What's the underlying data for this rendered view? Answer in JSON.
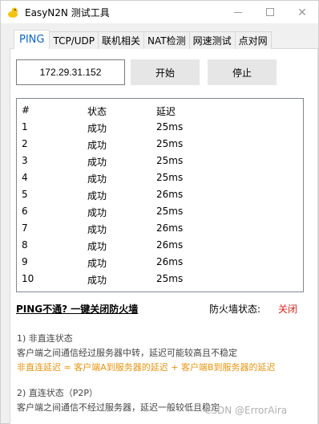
{
  "window": {
    "title": "EasyN2N 测试工具",
    "icon": "duck-icon"
  },
  "tabs": [
    {
      "label": "PING",
      "active": true
    },
    {
      "label": "TCP/UDP",
      "active": false
    },
    {
      "label": "联机相关",
      "active": false
    },
    {
      "label": "NAT检测",
      "active": false
    },
    {
      "label": "网速测试",
      "active": false
    },
    {
      "label": "点对网",
      "active": false
    }
  ],
  "controls": {
    "ip_value": "172.29.31.152",
    "start_label": "开始",
    "stop_label": "停止"
  },
  "results": {
    "headers": [
      "#",
      "状态",
      "延迟"
    ],
    "rows": [
      [
        "1",
        "成功",
        "25ms"
      ],
      [
        "2",
        "成功",
        "25ms"
      ],
      [
        "3",
        "成功",
        "25ms"
      ],
      [
        "4",
        "成功",
        "25ms"
      ],
      [
        "5",
        "成功",
        "26ms"
      ],
      [
        "6",
        "成功",
        "25ms"
      ],
      [
        "7",
        "成功",
        "26ms"
      ],
      [
        "8",
        "成功",
        "26ms"
      ],
      [
        "9",
        "成功",
        "26ms"
      ],
      [
        "10",
        "成功",
        "25ms"
      ]
    ]
  },
  "firewall": {
    "link_text": "PING不通? 一键关闭防火墙",
    "status_label": "防火墙状态:",
    "status_value": "关闭",
    "status_color": "#e02020"
  },
  "info": {
    "line1": "1) 非直连状态",
    "line2": "客户端之间通信经过服务器中转，延迟可能较高且不稳定",
    "line3": "非直连延迟 ≈ 客户端A到服务器的延迟 + 客户端B到服务器的延迟",
    "line4": "2) 直连状态（P2P）",
    "line5": "客户端之间通信不经过服务器，延迟一般较低且稳定"
  },
  "watermark": "CSDN @ErrorAira",
  "colors": {
    "accent": "#0a64c8",
    "orange_text": "#e89410"
  }
}
